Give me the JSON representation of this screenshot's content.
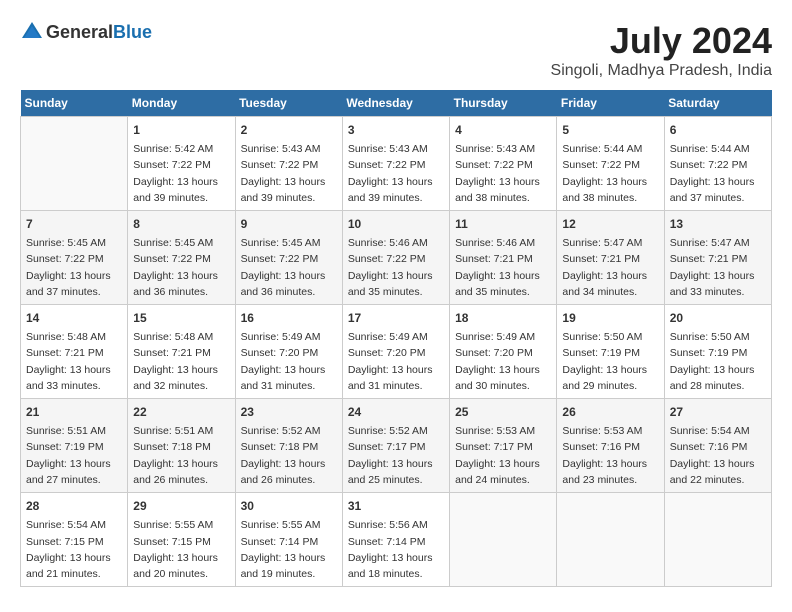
{
  "header": {
    "logo": {
      "text1": "General",
      "text2": "Blue"
    },
    "title": "July 2024",
    "location": "Singoli, Madhya Pradesh, India"
  },
  "days_of_week": [
    "Sunday",
    "Monday",
    "Tuesday",
    "Wednesday",
    "Thursday",
    "Friday",
    "Saturday"
  ],
  "weeks": [
    [
      {
        "day": "",
        "content": ""
      },
      {
        "day": "1",
        "content": "Sunrise: 5:42 AM\nSunset: 7:22 PM\nDaylight: 13 hours\nand 39 minutes."
      },
      {
        "day": "2",
        "content": "Sunrise: 5:43 AM\nSunset: 7:22 PM\nDaylight: 13 hours\nand 39 minutes."
      },
      {
        "day": "3",
        "content": "Sunrise: 5:43 AM\nSunset: 7:22 PM\nDaylight: 13 hours\nand 39 minutes."
      },
      {
        "day": "4",
        "content": "Sunrise: 5:43 AM\nSunset: 7:22 PM\nDaylight: 13 hours\nand 38 minutes."
      },
      {
        "day": "5",
        "content": "Sunrise: 5:44 AM\nSunset: 7:22 PM\nDaylight: 13 hours\nand 38 minutes."
      },
      {
        "day": "6",
        "content": "Sunrise: 5:44 AM\nSunset: 7:22 PM\nDaylight: 13 hours\nand 37 minutes."
      }
    ],
    [
      {
        "day": "7",
        "content": "Sunrise: 5:45 AM\nSunset: 7:22 PM\nDaylight: 13 hours\nand 37 minutes."
      },
      {
        "day": "8",
        "content": "Sunrise: 5:45 AM\nSunset: 7:22 PM\nDaylight: 13 hours\nand 36 minutes."
      },
      {
        "day": "9",
        "content": "Sunrise: 5:45 AM\nSunset: 7:22 PM\nDaylight: 13 hours\nand 36 minutes."
      },
      {
        "day": "10",
        "content": "Sunrise: 5:46 AM\nSunset: 7:22 PM\nDaylight: 13 hours\nand 35 minutes."
      },
      {
        "day": "11",
        "content": "Sunrise: 5:46 AM\nSunset: 7:21 PM\nDaylight: 13 hours\nand 35 minutes."
      },
      {
        "day": "12",
        "content": "Sunrise: 5:47 AM\nSunset: 7:21 PM\nDaylight: 13 hours\nand 34 minutes."
      },
      {
        "day": "13",
        "content": "Sunrise: 5:47 AM\nSunset: 7:21 PM\nDaylight: 13 hours\nand 33 minutes."
      }
    ],
    [
      {
        "day": "14",
        "content": "Sunrise: 5:48 AM\nSunset: 7:21 PM\nDaylight: 13 hours\nand 33 minutes."
      },
      {
        "day": "15",
        "content": "Sunrise: 5:48 AM\nSunset: 7:21 PM\nDaylight: 13 hours\nand 32 minutes."
      },
      {
        "day": "16",
        "content": "Sunrise: 5:49 AM\nSunset: 7:20 PM\nDaylight: 13 hours\nand 31 minutes."
      },
      {
        "day": "17",
        "content": "Sunrise: 5:49 AM\nSunset: 7:20 PM\nDaylight: 13 hours\nand 31 minutes."
      },
      {
        "day": "18",
        "content": "Sunrise: 5:49 AM\nSunset: 7:20 PM\nDaylight: 13 hours\nand 30 minutes."
      },
      {
        "day": "19",
        "content": "Sunrise: 5:50 AM\nSunset: 7:19 PM\nDaylight: 13 hours\nand 29 minutes."
      },
      {
        "day": "20",
        "content": "Sunrise: 5:50 AM\nSunset: 7:19 PM\nDaylight: 13 hours\nand 28 minutes."
      }
    ],
    [
      {
        "day": "21",
        "content": "Sunrise: 5:51 AM\nSunset: 7:19 PM\nDaylight: 13 hours\nand 27 minutes."
      },
      {
        "day": "22",
        "content": "Sunrise: 5:51 AM\nSunset: 7:18 PM\nDaylight: 13 hours\nand 26 minutes."
      },
      {
        "day": "23",
        "content": "Sunrise: 5:52 AM\nSunset: 7:18 PM\nDaylight: 13 hours\nand 26 minutes."
      },
      {
        "day": "24",
        "content": "Sunrise: 5:52 AM\nSunset: 7:17 PM\nDaylight: 13 hours\nand 25 minutes."
      },
      {
        "day": "25",
        "content": "Sunrise: 5:53 AM\nSunset: 7:17 PM\nDaylight: 13 hours\nand 24 minutes."
      },
      {
        "day": "26",
        "content": "Sunrise: 5:53 AM\nSunset: 7:16 PM\nDaylight: 13 hours\nand 23 minutes."
      },
      {
        "day": "27",
        "content": "Sunrise: 5:54 AM\nSunset: 7:16 PM\nDaylight: 13 hours\nand 22 minutes."
      }
    ],
    [
      {
        "day": "28",
        "content": "Sunrise: 5:54 AM\nSunset: 7:15 PM\nDaylight: 13 hours\nand 21 minutes."
      },
      {
        "day": "29",
        "content": "Sunrise: 5:55 AM\nSunset: 7:15 PM\nDaylight: 13 hours\nand 20 minutes."
      },
      {
        "day": "30",
        "content": "Sunrise: 5:55 AM\nSunset: 7:14 PM\nDaylight: 13 hours\nand 19 minutes."
      },
      {
        "day": "31",
        "content": "Sunrise: 5:56 AM\nSunset: 7:14 PM\nDaylight: 13 hours\nand 18 minutes."
      },
      {
        "day": "",
        "content": ""
      },
      {
        "day": "",
        "content": ""
      },
      {
        "day": "",
        "content": ""
      }
    ]
  ]
}
